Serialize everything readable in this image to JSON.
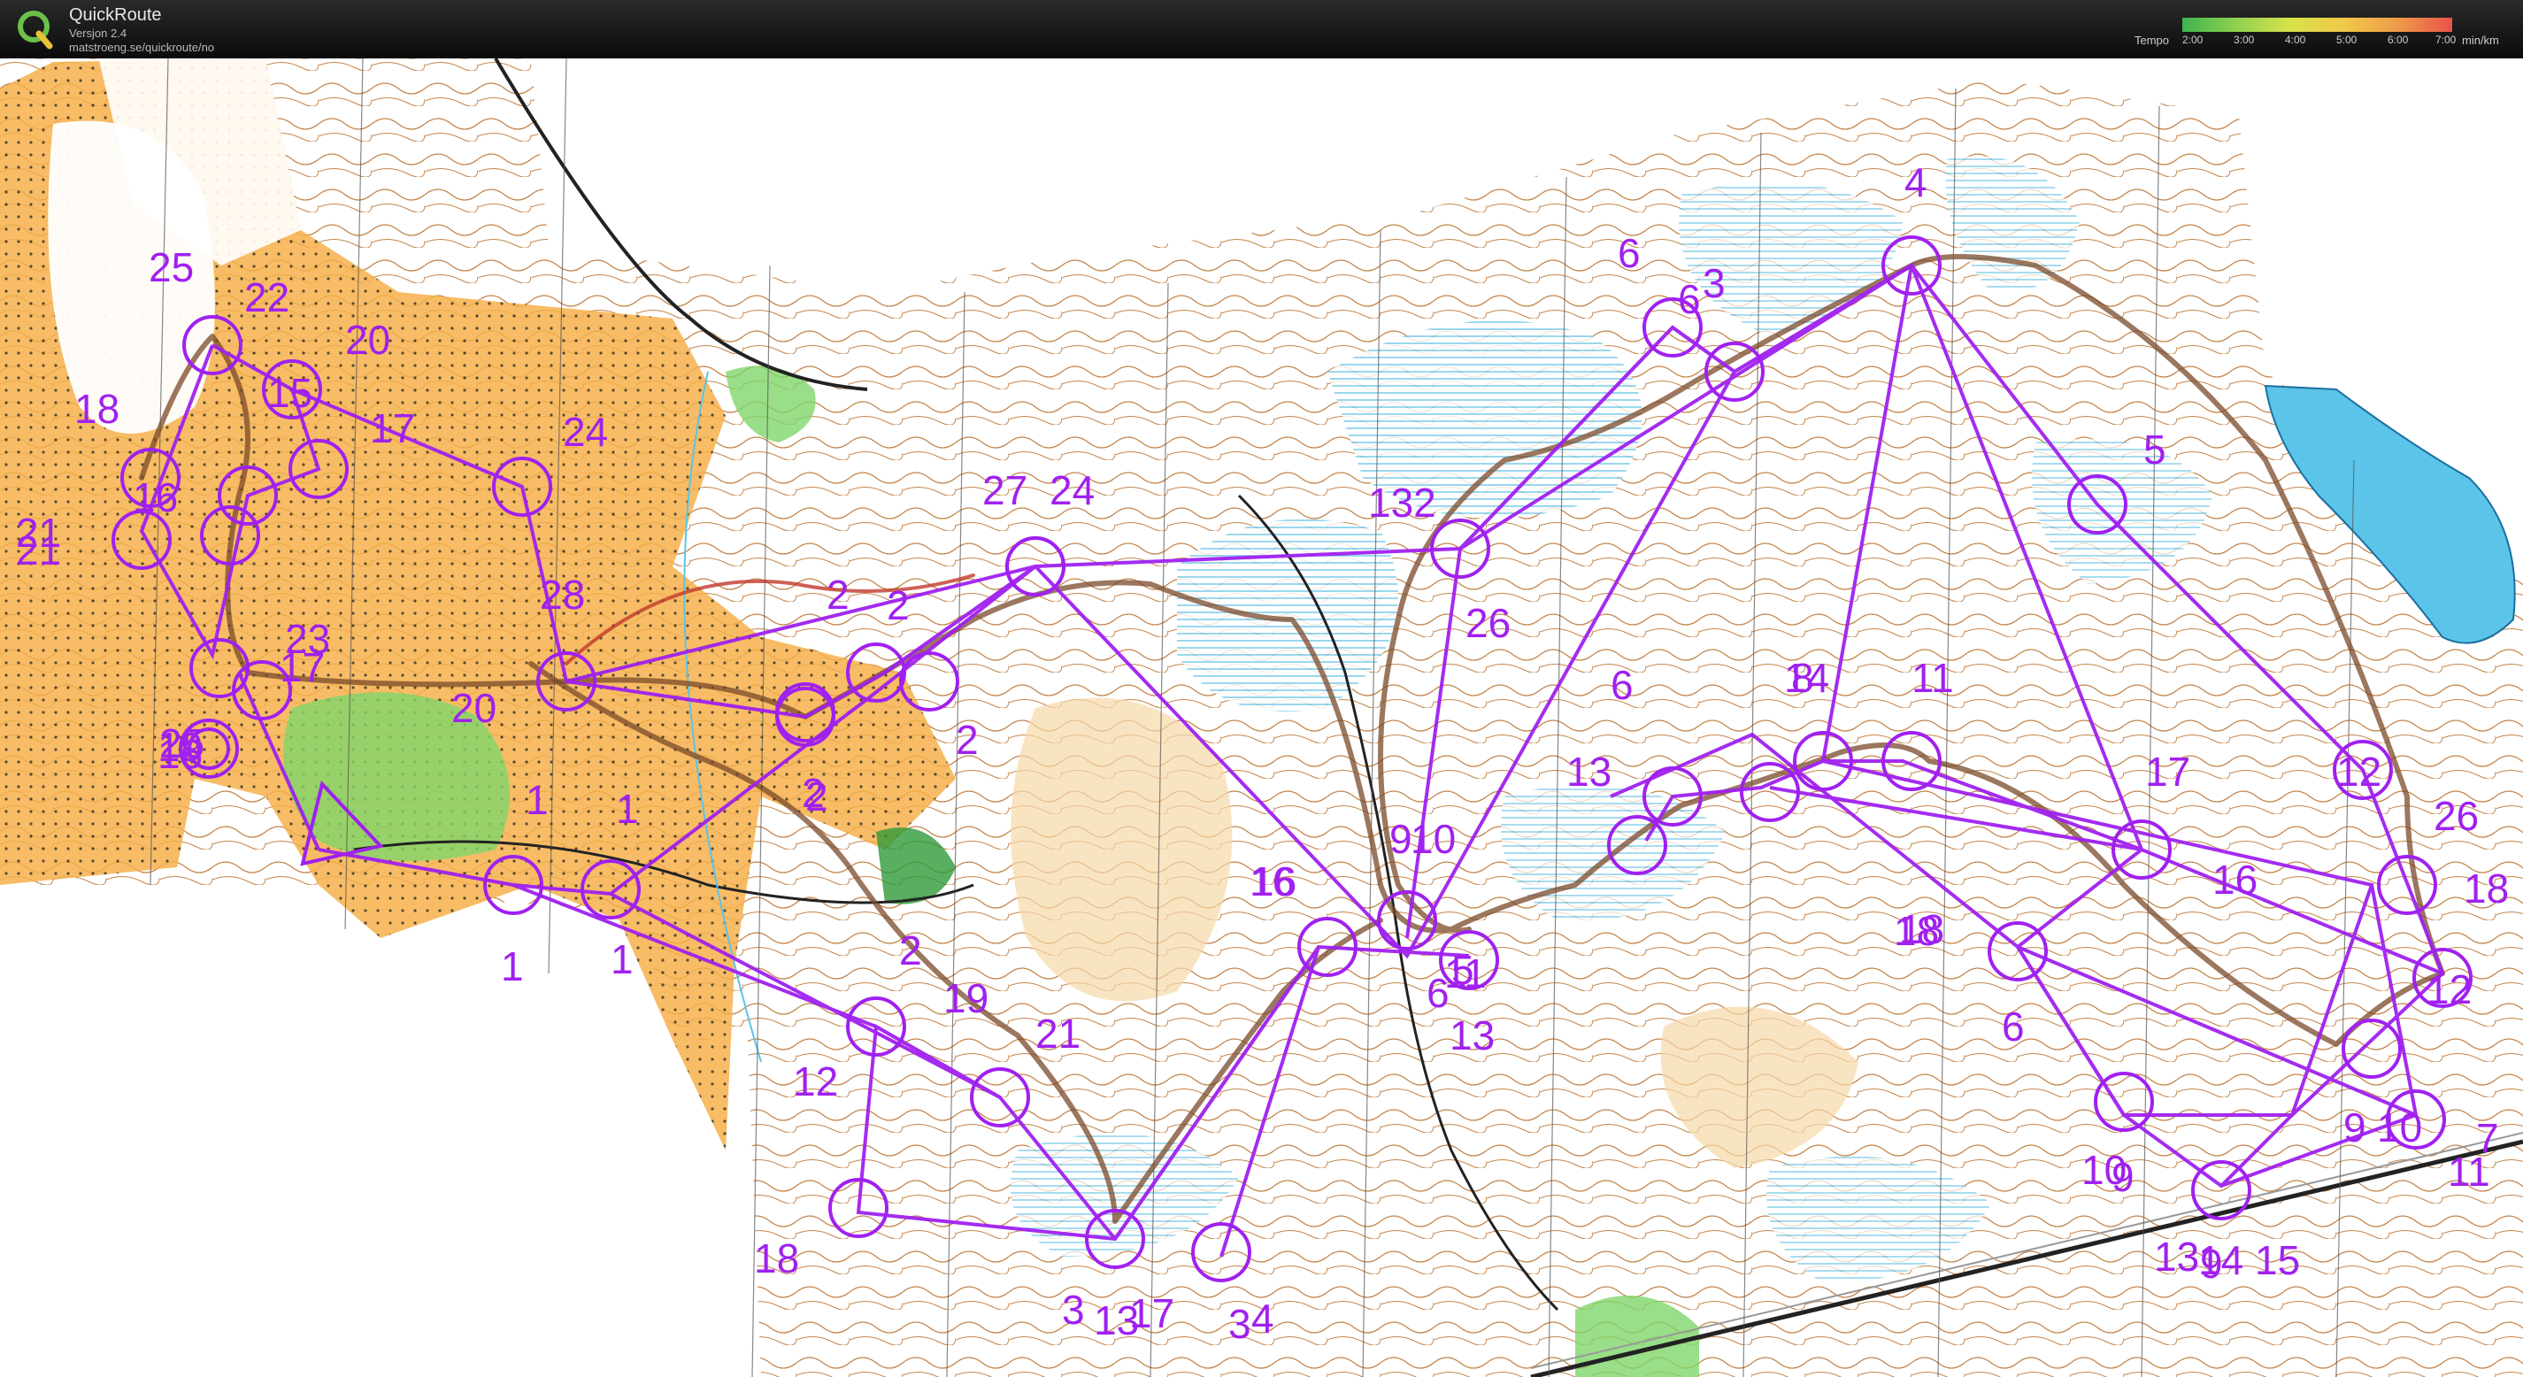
{
  "app": {
    "title": "QuickRoute",
    "version": "Versjon 2.4",
    "url": "matstroeng.se/quickroute/no"
  },
  "tempo_legend": {
    "label": "Tempo",
    "ticks": [
      "2:00",
      "3:00",
      "4:00",
      "5:00",
      "6:00",
      "7:00"
    ],
    "unit": "min/km",
    "colors": [
      "#3fb34f",
      "#8fd14f",
      "#d8e24a",
      "#f0c848",
      "#ef9a4a",
      "#e8534a"
    ]
  },
  "colors": {
    "course": "#a020f0",
    "forest_white": "#ffffff",
    "open_land": "#f5b04a",
    "green": "#7fd66a",
    "water_blue": "#8ed3ee",
    "marsh_blue": "#5bc4e8",
    "contour": "#b5651d",
    "route": "#7a4a2a"
  },
  "control_labels": [
    "25",
    "22",
    "20",
    "18",
    "15",
    "17",
    "24",
    "21",
    "21",
    "23",
    "25",
    "28",
    "16",
    "2",
    "28",
    "20",
    "17",
    "19",
    "16",
    "1",
    "1",
    "1",
    "1",
    "2",
    "2",
    "2",
    "2",
    "2",
    "27",
    "24",
    "132",
    "26",
    "6",
    "6",
    "4",
    "3",
    "5",
    "14",
    "8",
    "6",
    "11",
    "13",
    "17",
    "12",
    "26",
    "18",
    "16",
    "12",
    "7",
    "11",
    "9",
    "10",
    "9",
    "10",
    "14",
    "15",
    "18",
    "6",
    "11",
    "13",
    "9",
    "10",
    "18",
    "5",
    "6",
    "16",
    "16",
    "2",
    "19",
    "21",
    "12",
    "18",
    "3",
    "13",
    "17",
    "3",
    "4",
    "13",
    "9"
  ]
}
